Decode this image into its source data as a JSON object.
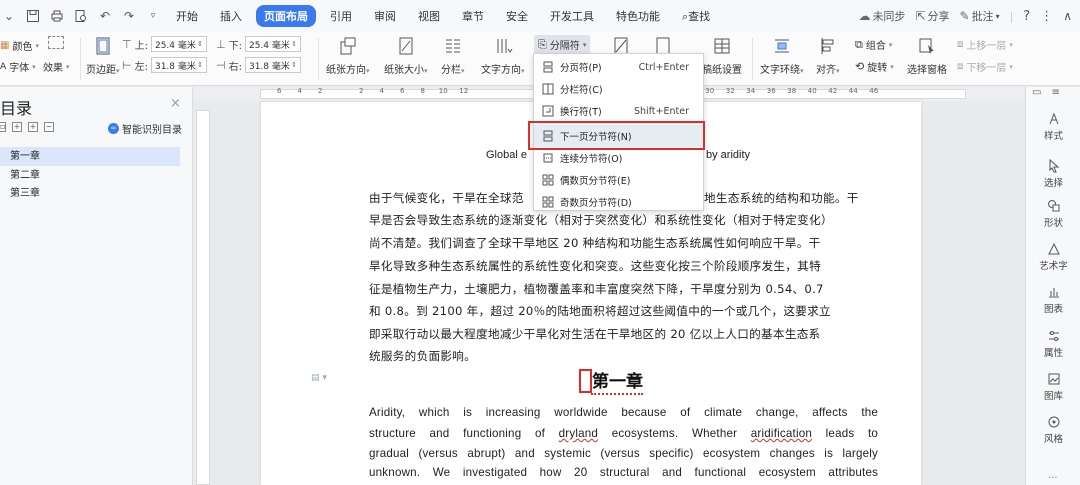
{
  "menubar": {
    "tabs": [
      "开始",
      "插入",
      "页面布局",
      "引用",
      "审阅",
      "视图",
      "章节",
      "安全",
      "开发工具",
      "特色功能",
      "查找"
    ],
    "active_tab": "页面布局",
    "right": {
      "sync": "未同步",
      "share": "分享",
      "comment": "批注",
      "help": "?",
      "more": "⋮",
      "collapse": "∧"
    }
  },
  "ribbon": {
    "color": "颜色",
    "font": "字体",
    "effect": "效果",
    "margin": "页边距",
    "top_label": "上:",
    "top_value": "25.4 毫米",
    "bottom_label": "下:",
    "bottom_value": "25.4 毫米",
    "left_label": "左:",
    "left_value": "31.8 毫米",
    "right_label": "右:",
    "right_value": "31.8 毫米",
    "orientation": "纸张方向",
    "size": "纸张大小",
    "columns": "分栏",
    "text_direction": "文字方向",
    "break": "分隔符",
    "draft_setting": "稿纸设置",
    "text_wrap": "文字环绕",
    "align": "对齐",
    "group": "组合",
    "rotate": "旋转",
    "selection_pane": "选择窗格",
    "up_layer": "上移一层",
    "down_layer": "下移一层"
  },
  "left_panel": {
    "title": "目录",
    "close": "×",
    "smart_toc": "智能识别目录",
    "items": [
      "第一章",
      "第二章",
      "第三章"
    ]
  },
  "ruler_numbers": [
    "6",
    "4",
    "2",
    "",
    "2",
    "4",
    "6",
    "8",
    "10",
    "12",
    "",
    "",
    "",
    "",
    "",
    "",
    "",
    "",
    "",
    "26",
    "28",
    "30",
    "32",
    "34",
    "36",
    "38",
    "40",
    "42",
    "44",
    "46"
  ],
  "document": {
    "title_left": "Global e",
    "title_right": "by aridity",
    "cn_lines": [
      "由于气候变化，干旱在全球范",
      "早是否会导致生态系统的逐渐变化（相对于突然变化）和系统性变化（相对于特定变化）",
      "尚不清楚。我们调查了全球干旱地区 20 种结构和功能生态系统属性如何响应干旱。干",
      "旱化导致多种生态系统属性的系统性变化和突变。这些变化按三个阶段顺序发生，其特",
      "征是植物生产力，土壤肥力，植物覆盖率和丰富度突然下降，干旱度分别为 0.54、0.7",
      "和 0.8。到 2100 年，超过 20％的陆地面积将超过这些阈值中的一个或几个，这要求立",
      "即采取行动以最大程度地减少干旱化对生活在干旱地区的 20 亿以上人口的基本生态系",
      "统服务的负面影响。"
    ],
    "cn_line1_right": "地生态系统的结构和功能。干",
    "chapter": "第一章",
    "en_lines": [
      [
        "Aridity,",
        "which",
        "is",
        "increasing",
        "worldwide",
        "because",
        "of",
        "climate",
        "change,",
        "affects",
        "the"
      ],
      [
        "structure",
        "and",
        "functioning",
        "of",
        "dryland",
        "ecosystems.",
        "Whether",
        "aridification",
        "leads",
        "to"
      ],
      [
        "gradual",
        "(versus",
        "abrupt)",
        "and",
        "systemic",
        "(versus",
        "specific)",
        "ecosystem",
        "changes",
        "is",
        "largely"
      ],
      [
        "unknown.",
        "We",
        "investigated",
        "how",
        "20",
        "structural",
        "and",
        "functional",
        "ecosystem",
        "attributes"
      ]
    ]
  },
  "dropdown": {
    "items": [
      {
        "label": "分页符(P)",
        "shortcut": "Ctrl+Enter",
        "icon": "page-break-icon"
      },
      {
        "label": "分栏符(C)",
        "shortcut": "",
        "icon": "column-break-icon"
      },
      {
        "label": "换行符(T)",
        "shortcut": "Shift+Enter",
        "icon": "line-break-icon"
      },
      {
        "label": "下一页分节符(N)",
        "shortcut": "",
        "icon": "next-page-section-icon"
      },
      {
        "label": "连续分节符(O)",
        "shortcut": "",
        "icon": "continuous-section-icon"
      },
      {
        "label": "偶数页分节符(E)",
        "shortcut": "",
        "icon": "even-page-section-icon"
      },
      {
        "label": "奇数页分节符(D)",
        "shortcut": "",
        "icon": "odd-page-section-icon"
      }
    ],
    "highlight_color": "#e02b2b"
  },
  "right_sidebar": {
    "items": [
      "样式",
      "选择",
      "形状",
      "艺术字",
      "图表",
      "属性",
      "图库",
      "风格"
    ],
    "more": "..."
  },
  "colors": {
    "accent": "#3a7af0",
    "highlight": "#e02b2b"
  }
}
